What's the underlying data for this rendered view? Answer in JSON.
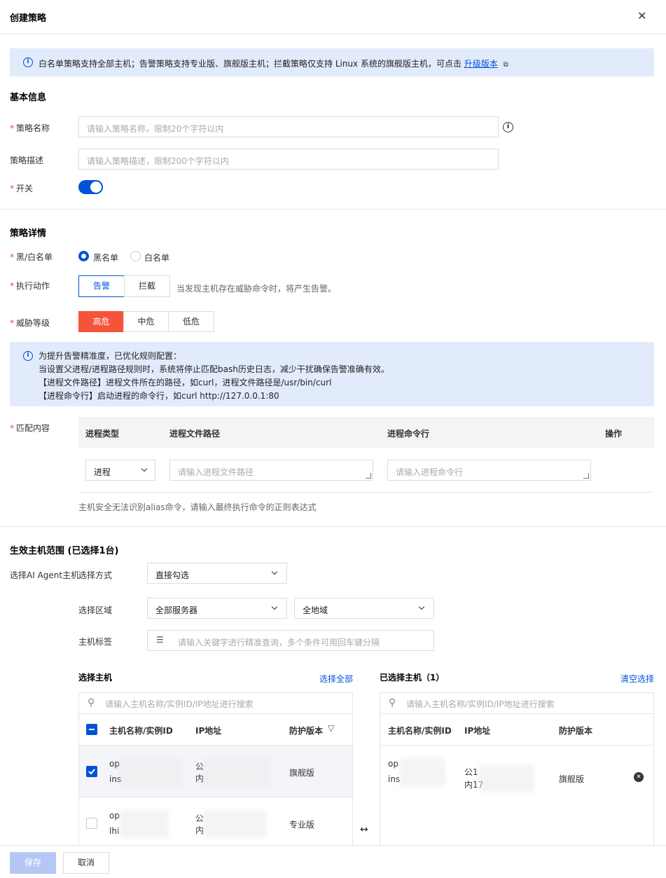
{
  "dialog": {
    "title": "创建策略"
  },
  "notice": {
    "text": "白名单策略支持全部主机；告警策略支持专业版、旗舰版主机；拦截策略仅支持 Linux 系统的旗舰版主机，可点击",
    "link": "升级版本"
  },
  "basic": {
    "title": "基本信息",
    "name_label": "策略名称",
    "name_placeholder": "请输入策略名称，限制20个字符以内",
    "desc_label": "策略描述",
    "desc_placeholder": "请输入策略描述，限制200个字符以内",
    "switch_label": "开关",
    "switch_on": true
  },
  "detail": {
    "title": "策略详情",
    "list_label": "黑/白名单",
    "list_options": [
      "黑名单",
      "白名单"
    ],
    "list_selected": "黑名单",
    "action_label": "执行动作",
    "action_options": [
      "告警",
      "拦截"
    ],
    "action_selected": "告警",
    "action_hint": "当发现主机存在威胁命令时，将产生告警。",
    "level_label": "威胁等级",
    "level_options": [
      "高危",
      "中危",
      "低危"
    ],
    "level_selected": "高危",
    "tip_lines": [
      "为提升告警精准度，已优化规则配置：",
      "当设置父进程/进程路径规则时，系统将停止匹配bash历史日志，减少干扰确保告警准确有效。",
      "【进程文件路径】进程文件所在的路径，如curl，进程文件路径是/usr/bin/curl",
      "【进程命令行】启动进程的命令行，如curl http://127.0.0.1:80"
    ],
    "match_label": "匹配内容",
    "match_headers": [
      "进程类型",
      "进程文件路径",
      "进程命令行",
      "操作"
    ],
    "match_row": {
      "type": "进程",
      "path_placeholder": "请输入进程文件路径",
      "cmd_placeholder": "请输入进程命令行"
    },
    "match_hint": "主机安全无法识别alias命令，请输入最终执行命令的正则表达式"
  },
  "scope": {
    "title": "生效主机范围 (已选择1台)",
    "agent_label": "选择AI Agent主机",
    "method_label": "选择方式",
    "method_value": "直接勾选",
    "region_label": "选择区域",
    "region_value": "全部服务器",
    "area_value": "全地域",
    "tag_label": "主机标签",
    "tag_placeholder": "请输入关键字进行精准查询，多个条件可用回车键分隔",
    "left": {
      "title": "选择主机",
      "action": "选择全部",
      "search_placeholder": "请输入主机名称/实例ID/IP地址进行搜索",
      "headers": [
        "主机名称/实例ID",
        "IP地址",
        "防护版本"
      ],
      "rows": [
        {
          "name1": "op",
          "name2": "ins",
          "ip1": "公",
          "ip2": "内",
          "version": "旗舰版",
          "checked": true
        },
        {
          "name1": "op",
          "name2": "lhi",
          "ip1": "公",
          "ip2": "内",
          "version": "专业版",
          "checked": false
        }
      ]
    },
    "right": {
      "title": "已选择主机（1）",
      "action": "清空选择",
      "search_placeholder": "请输入主机名称/实例ID/IP地址进行搜索",
      "headers": [
        "主机名称/实例ID",
        "IP地址",
        "防护版本"
      ],
      "rows": [
        {
          "name1": "op",
          "name2": "ins",
          "ip1": "公1",
          "ip2": "内17",
          "version": "旗舰版"
        }
      ]
    }
  },
  "footer": {
    "save": "保存",
    "cancel": "取消"
  },
  "colors": {
    "primary": "#0052d9",
    "danger": "#f5543a",
    "notice_bg": "#e2ebfc"
  }
}
